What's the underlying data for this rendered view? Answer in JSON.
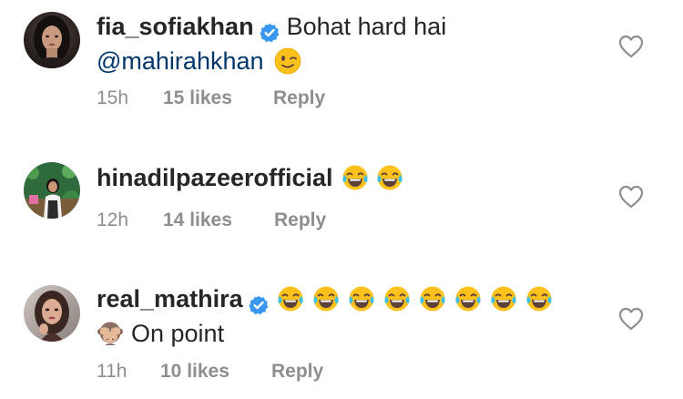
{
  "comments": [
    {
      "username": "fia_sofiakhan",
      "verified": true,
      "text": "Bohat hard hai",
      "mention": "@mahirahkhan",
      "emoji": [
        "winking-face"
      ],
      "time": "15h",
      "likes": "15 likes",
      "reply": "Reply"
    },
    {
      "username": "hinadilpazeerofficial",
      "verified": false,
      "text": "",
      "emoji": [
        "tears-of-joy",
        "tears-of-joy"
      ],
      "time": "12h",
      "likes": "14 likes",
      "reply": "Reply"
    },
    {
      "username": "real_mathira",
      "verified": true,
      "text": "On point",
      "emoji": [
        "tears-of-joy",
        "tears-of-joy",
        "tears-of-joy",
        "tears-of-joy",
        "tears-of-joy",
        "tears-of-joy",
        "tears-of-joy",
        "tears-of-joy",
        "see-no-evil-monkey"
      ],
      "time": "11h",
      "likes": "10 likes",
      "reply": "Reply"
    }
  ],
  "colors": {
    "username": "#262626",
    "text": "#262626",
    "mention": "#00376b",
    "meta": "#8e8e8e",
    "verified_badge": "#3897f0",
    "heart_outline": "#8e8e8e"
  }
}
